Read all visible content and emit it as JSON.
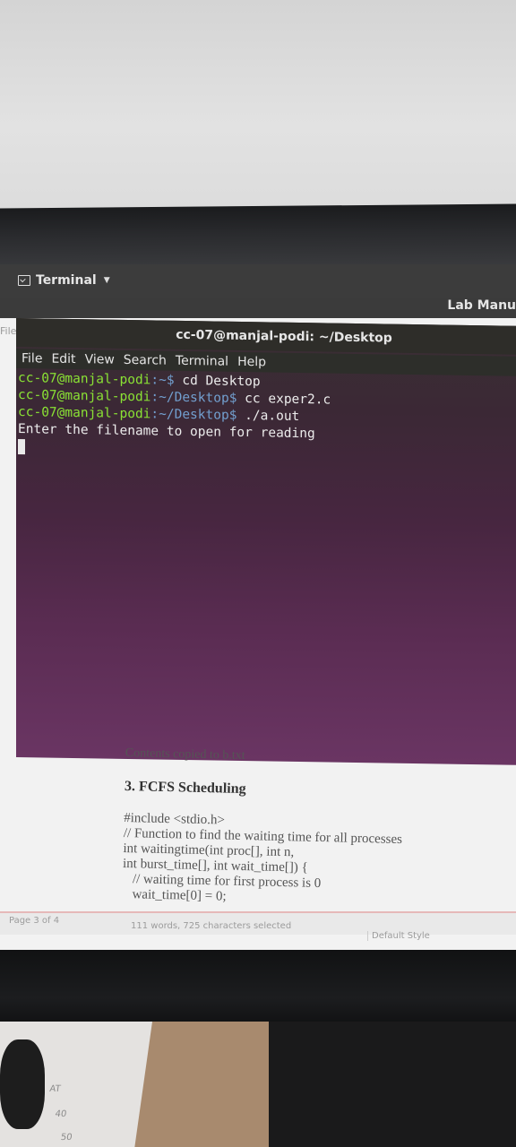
{
  "topbar": {
    "app_label": "Terminal"
  },
  "writer": {
    "window_title": "Lab Manu",
    "menu_file_cut": "File"
  },
  "terminal": {
    "title": "cc-07@manjal-podi: ~/Desktop",
    "menu": [
      "File",
      "Edit",
      "View",
      "Search",
      "Terminal",
      "Help"
    ],
    "lines": [
      {
        "prompt": "cc-07@manjal-podi",
        "path": ":~$",
        "cmd": " cd Desktop"
      },
      {
        "prompt": "cc-07@manjal-podi",
        "path": ":~/Desktop$",
        "cmd": " cc exper2.c"
      },
      {
        "prompt": "cc-07@manjal-podi",
        "path": ":~/Desktop$",
        "cmd": " ./a.out"
      }
    ],
    "output": "Enter the filename to open for reading"
  },
  "document": {
    "cut_line": "Contents copied to b.txt",
    "heading": "3. FCFS Scheduling",
    "code": [
      "#include <stdio.h>",
      "// Function to find the waiting time for all processes",
      "int waitingtime(int proc[], int n,",
      "int burst_time[], int wait_time[]) {",
      "   // waiting time for first process is 0",
      "   wait_time[0] = 0;"
    ]
  },
  "statusbar": {
    "page": "Page 3 of 4",
    "words": "111 words, 725 characters selected",
    "style": "Default Style"
  },
  "desk_paper": [
    "AT",
    "40",
    "50"
  ]
}
